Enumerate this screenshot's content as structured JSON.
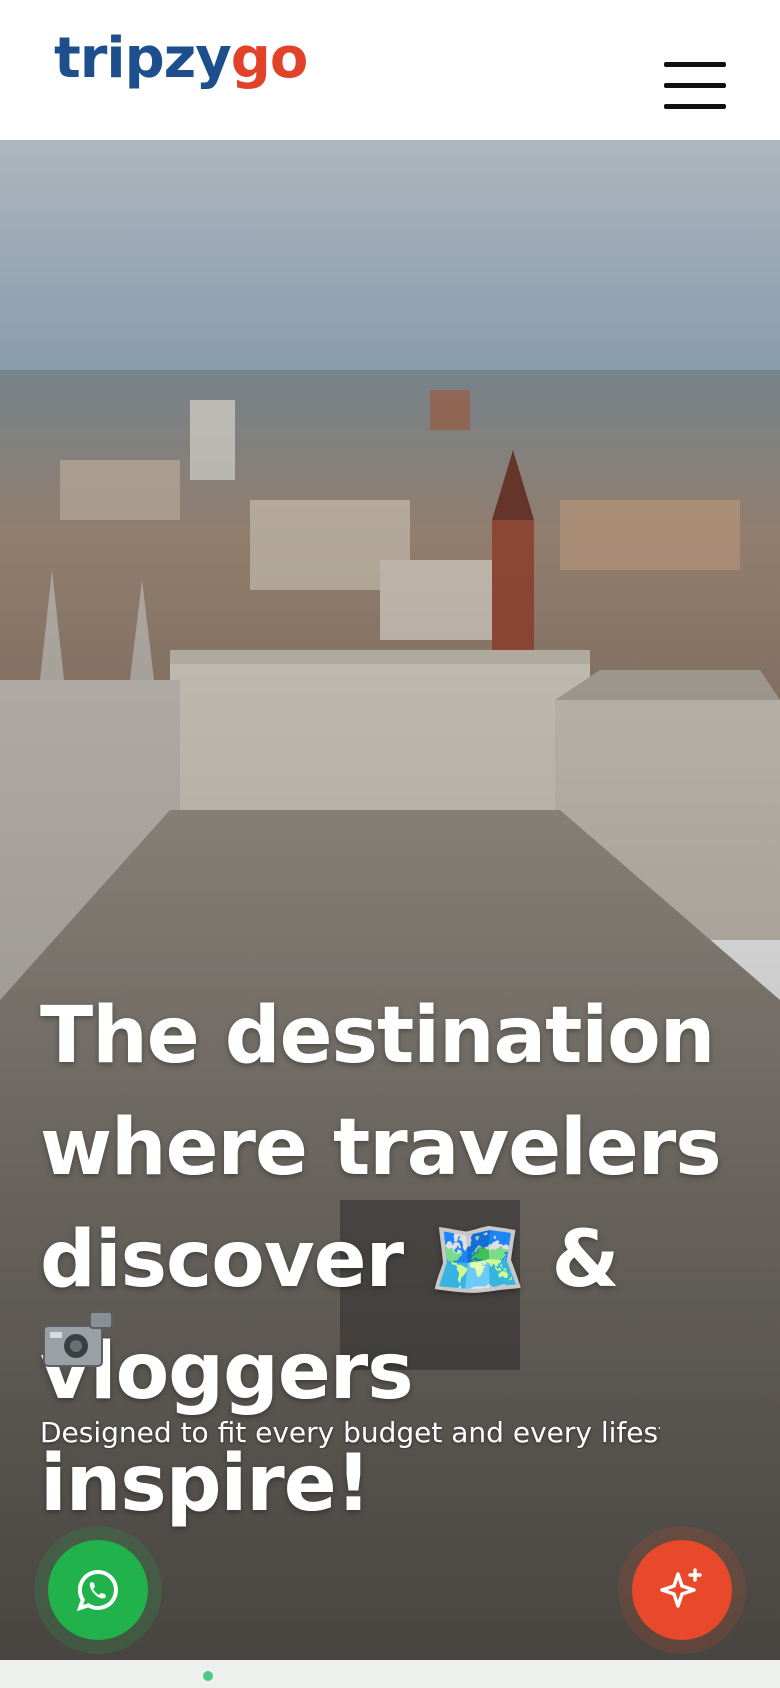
{
  "header": {
    "logo_part1": "tripzy",
    "logo_part2": "go",
    "menu_icon": "hamburger-icon"
  },
  "hero": {
    "headline_line1": "The destination",
    "headline_line2": "where travelers",
    "headline_line3_text": "discover",
    "headline_line3_emoji": "🗺️",
    "headline_line3_end": "&",
    "headline_line4": "vloggers inspire!",
    "camera_icon": "video-camera-icon",
    "subtext": "Designed to fit every budget and every lifestyle"
  },
  "floating_buttons": {
    "whatsapp_icon": "whatsapp-icon",
    "ai_icon": "sparkle-icon"
  },
  "colors": {
    "logo_blue": "#1d4f8c",
    "logo_red": "#e2422a",
    "whatsapp_green": "#22b24c",
    "ai_orange": "#e8492a"
  }
}
